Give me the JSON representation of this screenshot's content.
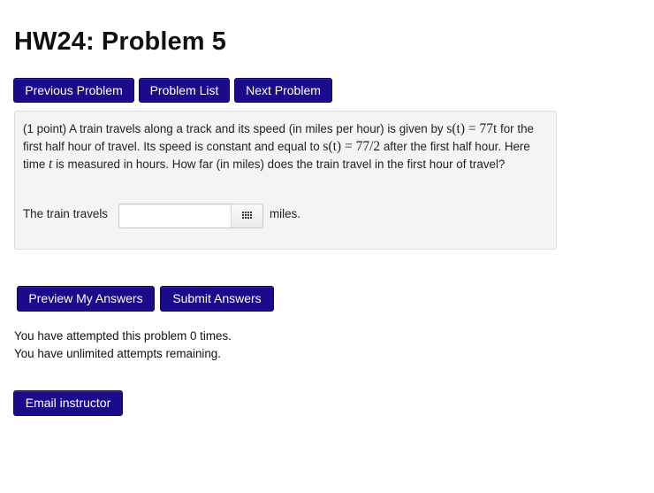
{
  "page": {
    "title": "HW24: Problem 5"
  },
  "nav": {
    "previous_label": "Previous Problem",
    "list_label": "Problem List",
    "next_label": "Next Problem"
  },
  "problem": {
    "intro": "(1 point) A train travels along a track and its speed (in miles per hour) is given by ",
    "speed_formula_1": "s(t) = 77t",
    "text_2": " for the first half hour of travel. Its speed is constant and equal to ",
    "speed_formula_2": "s(t) = 77/2",
    "text_3": " after the first half hour. Here time ",
    "time_var": "t",
    "text_4": " is measured in hours. How far (in miles) does the train travel in the first hour of travel?"
  },
  "answer": {
    "label": "The train travels",
    "value": "",
    "placeholder": "",
    "units": "miles."
  },
  "actions": {
    "preview_label": "Preview My Answers",
    "submit_label": "Submit Answers",
    "email_label": "Email instructor"
  },
  "status": {
    "attempted": "You have attempted this problem 0 times.",
    "remaining": "You have unlimited attempts remaining."
  },
  "colors": {
    "button_bg": "#1a0a8c",
    "problem_bg": "#f4f4f4"
  }
}
